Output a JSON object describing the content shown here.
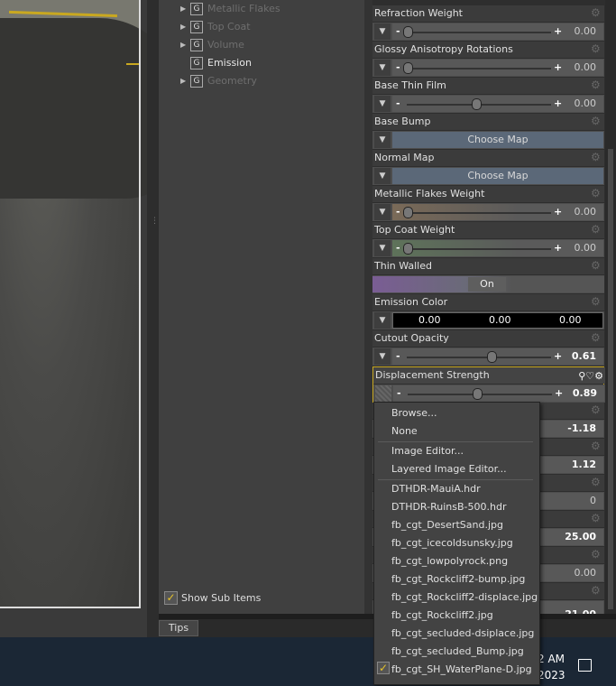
{
  "tree": {
    "items": [
      {
        "label": "Metallic Flakes",
        "expander": "▶",
        "state": "dim"
      },
      {
        "label": "Top Coat",
        "expander": "▶",
        "state": "dim"
      },
      {
        "label": "Volume",
        "expander": "▶",
        "state": "dim"
      },
      {
        "label": "Emission",
        "expander": "",
        "state": "bright"
      },
      {
        "label": "Geometry",
        "expander": "▶",
        "state": "dim"
      }
    ],
    "group_glyph": "G",
    "show_sub_items": {
      "label": "Show Sub Items",
      "checked": true
    }
  },
  "properties": [
    {
      "title": "Refraction Weight",
      "control": "slider",
      "value": "0.00",
      "level": 0.0
    },
    {
      "title": "Glossy Anisotropy Rotations",
      "control": "slider",
      "value": "0.00",
      "level": 0.0
    },
    {
      "title": "Base Thin Film",
      "control": "slider",
      "value": "0.00",
      "level": 0.5
    },
    {
      "title": "Base Bump",
      "control": "map",
      "value": "Choose Map"
    },
    {
      "title": "Normal Map",
      "control": "map",
      "value": "Choose Map"
    },
    {
      "title": "Metallic Flakes Weight",
      "control": "slider",
      "value": "0.00",
      "level": 0.0
    },
    {
      "title": "Top Coat Weight",
      "control": "slider",
      "value": "0.00",
      "level": 0.0
    },
    {
      "title": "Thin Walled",
      "control": "toggle",
      "value": "On"
    },
    {
      "title": "Emission Color",
      "control": "color",
      "values": [
        "0.00",
        "0.00",
        "0.00"
      ]
    },
    {
      "title": "Cutout Opacity",
      "control": "slider",
      "value": "0.61",
      "level": 0.61
    },
    {
      "title": "Displacement Strength",
      "control": "slider",
      "value": "0.89",
      "level": 0.5
    }
  ],
  "hidden_values": [
    "-1.18",
    "1.12",
    "0",
    "25.00",
    "0.00",
    "21.00"
  ],
  "tips_tab": "Tips",
  "context_menu": {
    "items": [
      {
        "label": "Browse..."
      },
      {
        "label": "None"
      },
      {
        "label": "Image Editor..."
      },
      {
        "label": "Layered Image Editor..."
      },
      {
        "label": "DTHDR-MauiA.hdr"
      },
      {
        "label": "DTHDR-RuinsB-500.hdr"
      },
      {
        "label": "fb_cgt_DesertSand.jpg"
      },
      {
        "label": "fb_cgt_icecoldsunsky.jpg"
      },
      {
        "label": "fb_cgt_lowpolyrock.png"
      },
      {
        "label": "fb_cgt_Rockcliff2-bump.jpg"
      },
      {
        "label": "fb_cgt_Rockcliff2-displace.jpg"
      },
      {
        "label": "fb_cgt_Rockcliff2.jpg"
      },
      {
        "label": "fb_cgt_secluded-dsiplace.jpg"
      },
      {
        "label": "fb_cgt_secluded_Bump.jpg"
      },
      {
        "label": "fb_cgt_SH_WaterPlane-D.jpg",
        "checked": true
      }
    ]
  },
  "taskbar": {
    "time": "2 AM",
    "date": "2023"
  },
  "colors": {
    "accent": "#c9a820",
    "map_button": "#5b6878",
    "taskbar": "#1b2735"
  }
}
